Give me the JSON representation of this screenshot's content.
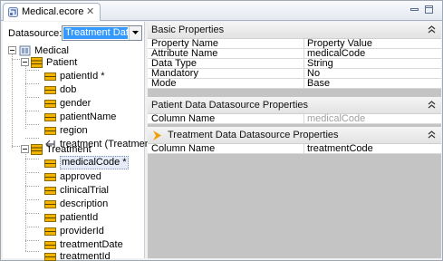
{
  "editor": {
    "tab_title": "Medical.ecore",
    "close_glyph": "✕",
    "icons": {
      "tab": "ecore-file-icon",
      "minimize": "minimize-icon",
      "maximize": "maximize-icon"
    }
  },
  "datasource": {
    "label": "Datasource:",
    "selected": "Treatment Data"
  },
  "tree": {
    "root": "Medical",
    "patient": {
      "label": "Patient",
      "fields": [
        "patientId *",
        "dob",
        "gender",
        "patientName",
        "region",
        "treatment (Treatment)"
      ]
    },
    "treatment": {
      "label": "Treatment",
      "fields": [
        "medicalCode *",
        "approved",
        "clinicalTrial",
        "description",
        "patientId",
        "providerId",
        "treatmentDate",
        "treatmentId"
      ]
    }
  },
  "basic": {
    "title": "Basic Properties",
    "header_name": "Property Name",
    "header_value": "Property Value",
    "rows": [
      {
        "name": "Attribute Name",
        "value": "medicalCode"
      },
      {
        "name": "Data Type",
        "value": "String"
      },
      {
        "name": "Mandatory",
        "value": "No"
      },
      {
        "name": "Mode",
        "value": "Base"
      }
    ]
  },
  "patient_ds": {
    "title": "Patient Data Datasource Properties",
    "name": "Column Name",
    "value": "medicalCode"
  },
  "treatment_ds": {
    "title": "Treatment Data Datasource Properties",
    "name": "Column Name",
    "value": "treatmentCode"
  },
  "colors": {
    "selection": "#3399ff",
    "accent_arrow": "#f0a000",
    "panel_gray": "#c4c4c4",
    "class_icon": "#f2b400"
  }
}
